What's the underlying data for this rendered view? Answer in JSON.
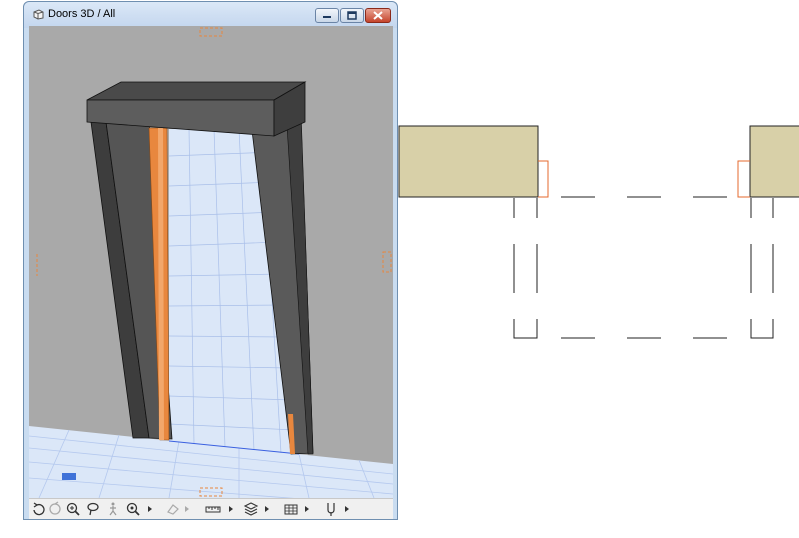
{
  "window": {
    "title": "Doors 3D / All"
  },
  "icons": {
    "title": "3d-window-icon",
    "minimize": "minimize-icon",
    "maximize": "maximize-icon",
    "close": "close-icon"
  },
  "toolbar": {
    "items": [
      "orbit-icon",
      "undo-view-icon",
      "zoom-icon",
      "lasso-icon",
      "walk-icon",
      "zoom-options-icon",
      "disabled-tool-icon",
      "measure-icon",
      "layers-icon",
      "render-style-icon",
      "marker-icon"
    ]
  },
  "colors": {
    "frame": "#585858",
    "frame_dark": "#3a3a3a",
    "door_leaf": "#e8873e",
    "floor": "#dbe7f8",
    "grid": "#9fb7e8",
    "wall_plan": "#d8d0a8",
    "plan_accent": "#e46a2e"
  }
}
